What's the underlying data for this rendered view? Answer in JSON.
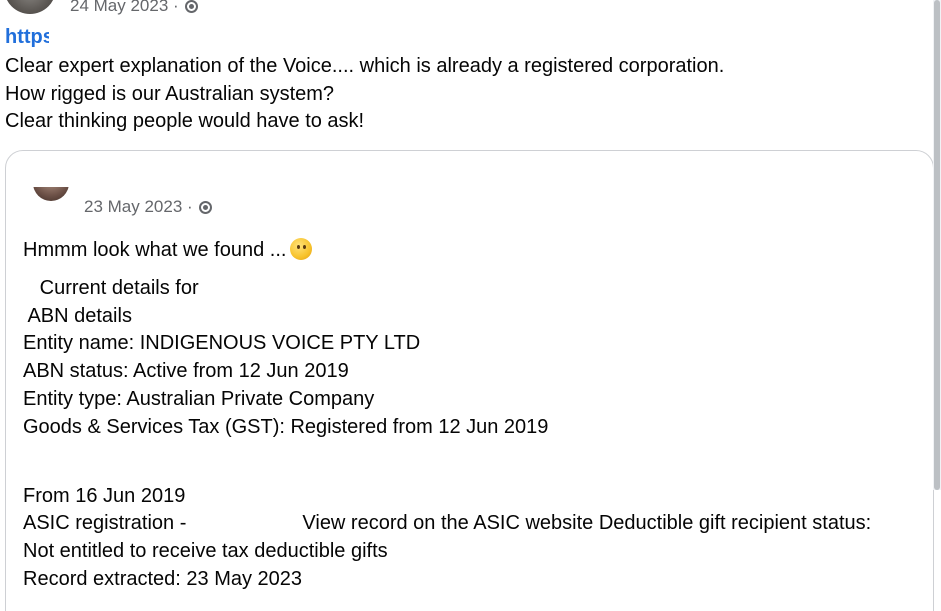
{
  "post": {
    "date": "24 May 2023 ·",
    "link_text": "https",
    "text_lines": [
      "Clear expert explanation of the Voice.... which is already a registered corporation.",
      "How rigged is our Australian system?",
      "Clear thinking people would have to ask!"
    ]
  },
  "shared": {
    "date": "23 May 2023 ·",
    "intro": "Hmmm look what we found ...",
    "emoji": "thinking-face",
    "lines_block1": [
      "   Current details for",
      " ABN details",
      "Entity name: INDIGENOUS VOICE PTY LTD",
      "ABN status: Active from 12 Jun 2019",
      "Entity type: Australian Private Company",
      "Goods & Services Tax (GST): Registered from 12 Jun 2019"
    ],
    "from_line": "From 16 Jun 2019",
    "asic_prefix": "ASIC registration -",
    "asic_suffix": "View record on the ASIC website Deductible gift recipient status:",
    "dgr_line": "Not entitled to receive tax deductible gifts",
    "record_line": "Record extracted: 23 May 2023"
  },
  "colors": {
    "link": "#216fdb",
    "text": "#050505",
    "muted": "#65676b",
    "border": "#ced0d4"
  }
}
